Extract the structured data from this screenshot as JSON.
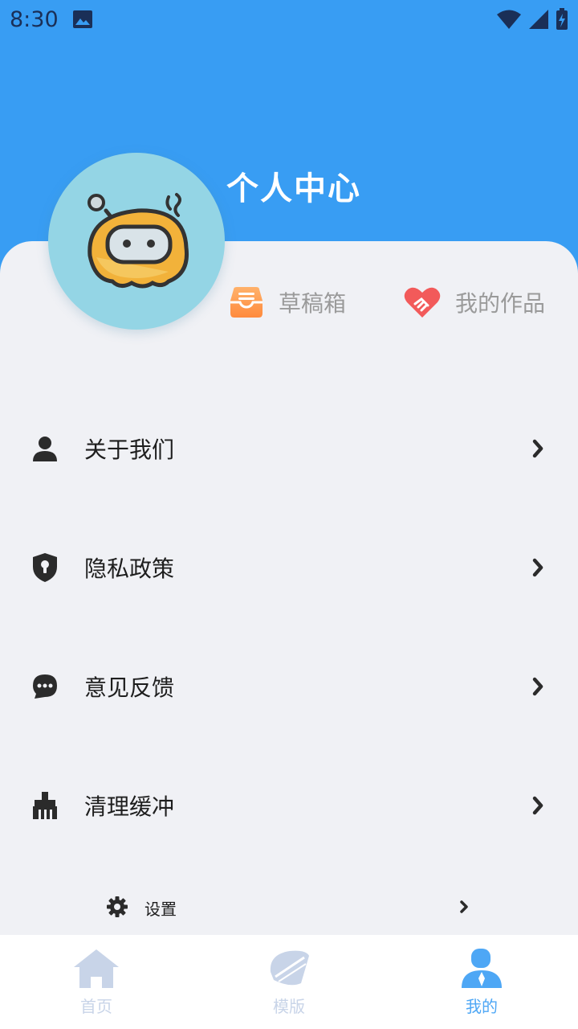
{
  "status_bar": {
    "time": "8:30",
    "icons": [
      "image-icon",
      "wifi-icon",
      "signal-icon",
      "battery-charging-icon"
    ]
  },
  "header": {
    "title": "个人中心",
    "background_color": "#389df3"
  },
  "quick_links": [
    {
      "label": "草稿箱",
      "icon": "draft-box-icon"
    },
    {
      "label": "我的作品",
      "icon": "handshake-heart-icon"
    }
  ],
  "menu": [
    {
      "label": "关于我们",
      "icon": "person-icon"
    },
    {
      "label": "隐私政策",
      "icon": "shield-lock-icon"
    },
    {
      "label": "意见反馈",
      "icon": "chat-bubble-icon"
    },
    {
      "label": "清理缓冲",
      "icon": "broom-icon"
    }
  ],
  "settings": {
    "label": "设置",
    "icon": "gear-icon"
  },
  "bottom_nav": [
    {
      "label": "首页",
      "icon": "home-icon",
      "active": false
    },
    {
      "label": "模版",
      "icon": "template-icon",
      "active": false
    },
    {
      "label": "我的",
      "icon": "user-icon",
      "active": true
    }
  ],
  "colors": {
    "accent": "#389df3",
    "nav_inactive": "#c8d4e8",
    "nav_active": "#4ea7f5"
  }
}
